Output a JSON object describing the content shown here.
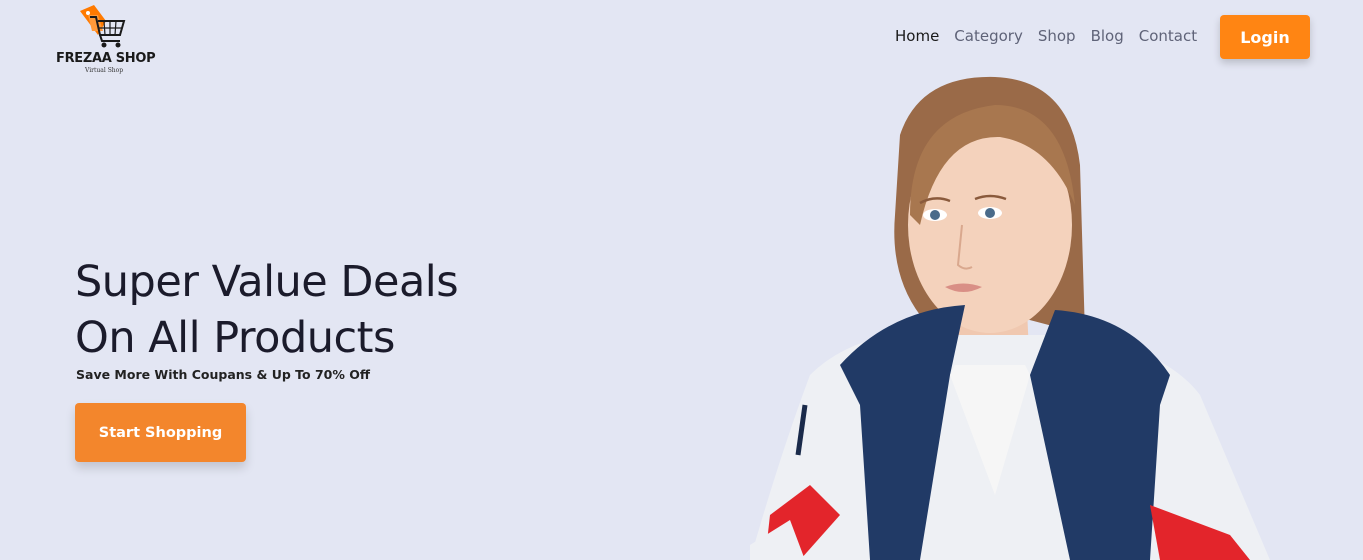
{
  "brand": {
    "name": "FREZAA SHOP",
    "tagline": "Virtual Shop",
    "accent_color": "#ff8513",
    "icon": "shopping-cart-tag-icon"
  },
  "nav": {
    "items": [
      {
        "label": "Home",
        "active": true
      },
      {
        "label": "Category",
        "active": false
      },
      {
        "label": "Shop",
        "active": false
      },
      {
        "label": "Blog",
        "active": false
      },
      {
        "label": "Contact",
        "active": false
      }
    ],
    "login_label": "Login"
  },
  "hero": {
    "title_line1": "Super Value Deals",
    "title_line2": "On All Products",
    "subtitle": "Save More With Coupans & Up To 70% Off",
    "cta_label": "Start Shopping",
    "cta_color": "#f3862c",
    "background": "#e3e6f3"
  }
}
